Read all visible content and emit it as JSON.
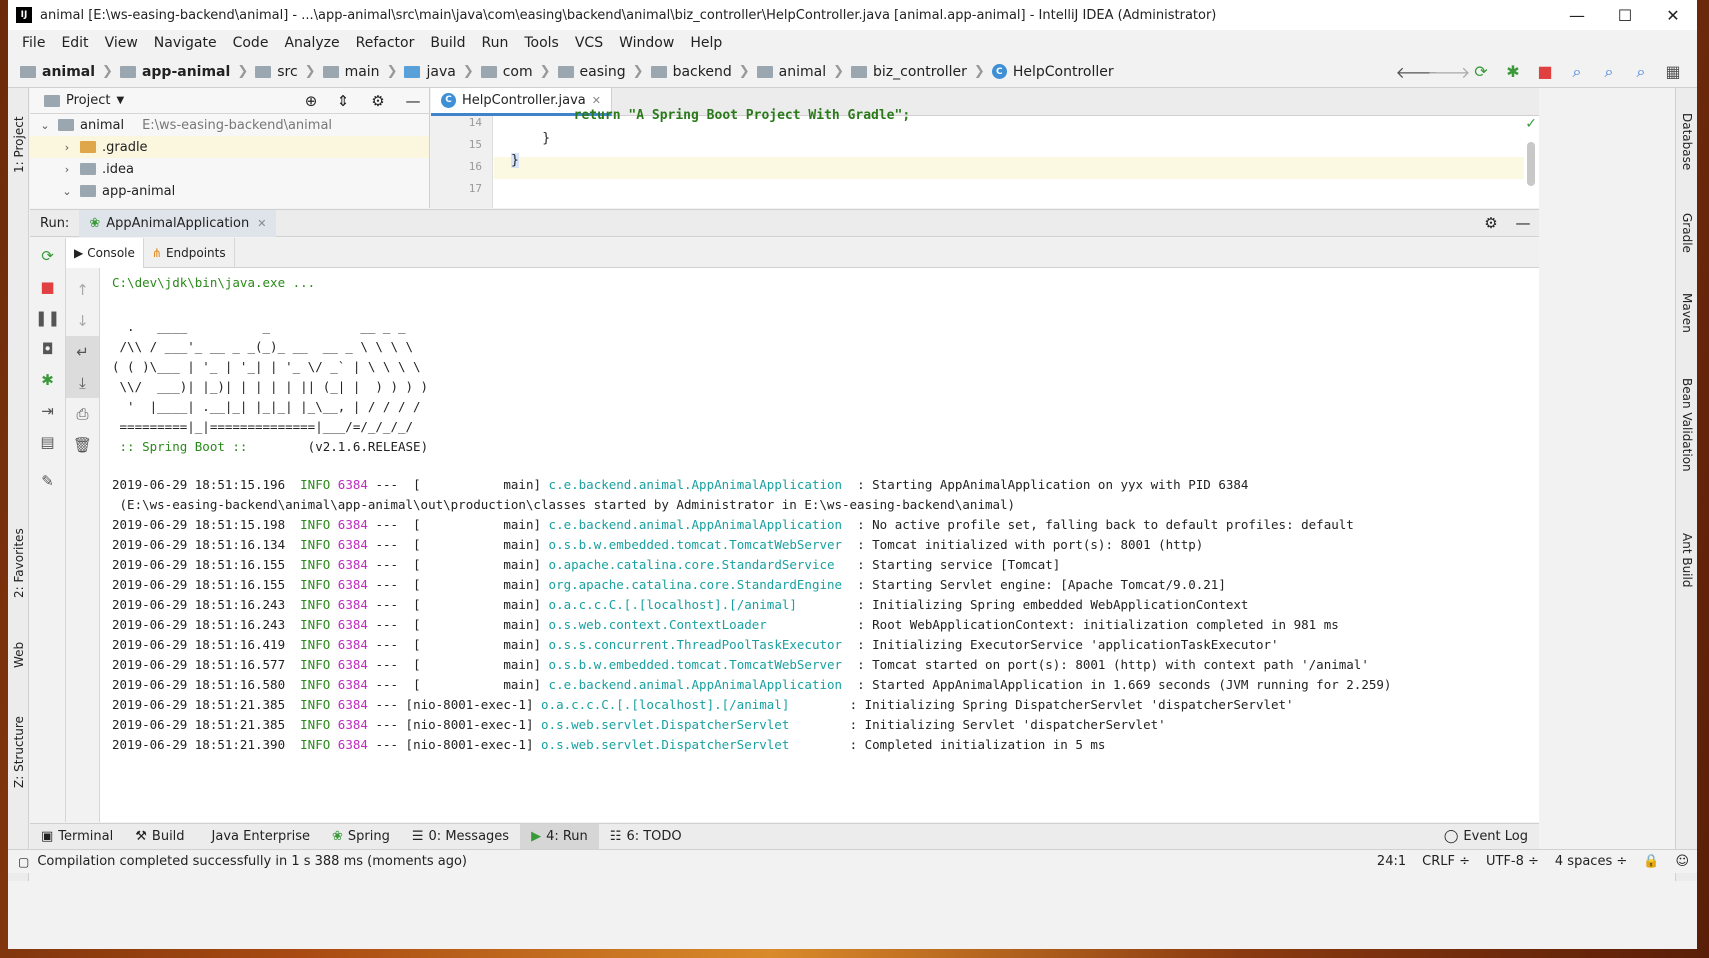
{
  "window": {
    "title": "animal [E:\\ws-easing-backend\\animal] - ...\\app-animal\\src\\main\\java\\com\\easing\\backend\\animal\\biz_controller\\HelpController.java [animal.app-animal] - IntelliJ IDEA (Administrator)",
    "logo": "IJ",
    "minimize": "—",
    "maximize": "☐",
    "close": "✕"
  },
  "menu": [
    "File",
    "Edit",
    "View",
    "Navigate",
    "Code",
    "Analyze",
    "Refactor",
    "Build",
    "Run",
    "Tools",
    "VCS",
    "Window",
    "Help"
  ],
  "breadcrumbs": [
    "animal",
    "app-animal",
    "src",
    "main",
    "java",
    "com",
    "easing",
    "backend",
    "animal",
    "biz_controller",
    "HelpController"
  ],
  "project_panel": {
    "title": "Project",
    "tree": [
      {
        "name": "animal",
        "path": "E:\\ws-easing-backend\\animal",
        "level": 0,
        "expanded": true
      },
      {
        "name": ".gradle",
        "level": 1,
        "expanded": false
      },
      {
        "name": ".idea",
        "level": 1,
        "expanded": false
      },
      {
        "name": "app-animal",
        "level": 1,
        "expanded": true
      }
    ]
  },
  "editor": {
    "tab": "HelpController.java",
    "lines": [
      {
        "no": "14",
        "text": "        return \"A Spring Boot Project With Gradle\";"
      },
      {
        "no": "15",
        "text": "    }"
      },
      {
        "no": "16",
        "text": "}"
      },
      {
        "no": "17",
        "text": ""
      }
    ]
  },
  "run": {
    "label": "Run:",
    "config": "AppAnimalApplication",
    "tabs": [
      "Console",
      "Endpoints"
    ]
  },
  "console": {
    "command": "C:\\dev\\jdk\\bin\\java.exe ...",
    "banner": [
      "  .   ____          _            __ _ _",
      " /\\\\ / ___'_ __ _ _(_)_ __  __ _ \\ \\ \\ \\",
      "( ( )\\___ | '_ | '_| | '_ \\/ _` | \\ \\ \\ \\",
      " \\\\/  ___)| |_)| | | | | || (_| |  ) ) ) )",
      "  '  |____| .__|_| |_|_| |_\\__, | / / / /",
      " =========|_|==============|___/=/_/_/_/"
    ],
    "boot_label": " :: Spring Boot :: ",
    "boot_version": "       (v2.1.6.RELEASE)",
    "logs": [
      {
        "ts": "2019-06-29 18:51:15.196",
        "level": "INFO",
        "pid": "6384",
        "thread": "---  [           main]",
        "logger": "c.e.backend.animal.AppAnimalApplication ",
        "msg": " : Starting AppAnimalApplication on yyx with PID 6384"
      },
      {
        "cont": " (E:\\ws-easing-backend\\animal\\app-animal\\out\\production\\classes started by Administrator in E:\\ws-easing-backend\\animal)"
      },
      {
        "ts": "2019-06-29 18:51:15.198",
        "level": "INFO",
        "pid": "6384",
        "thread": "---  [           main]",
        "logger": "c.e.backend.animal.AppAnimalApplication ",
        "msg": " : No active profile set, falling back to default profiles: default"
      },
      {
        "ts": "2019-06-29 18:51:16.134",
        "level": "INFO",
        "pid": "6384",
        "thread": "---  [           main]",
        "logger": "o.s.b.w.embedded.tomcat.TomcatWebServer ",
        "msg": " : Tomcat initialized with port(s): 8001 (http)"
      },
      {
        "ts": "2019-06-29 18:51:16.155",
        "level": "INFO",
        "pid": "6384",
        "thread": "---  [           main]",
        "logger": "o.apache.catalina.core.StandardService  ",
        "msg": " : Starting service [Tomcat]"
      },
      {
        "ts": "2019-06-29 18:51:16.155",
        "level": "INFO",
        "pid": "6384",
        "thread": "---  [           main]",
        "logger": "org.apache.catalina.core.StandardEngine ",
        "msg": " : Starting Servlet engine: [Apache Tomcat/9.0.21]"
      },
      {
        "ts": "2019-06-29 18:51:16.243",
        "level": "INFO",
        "pid": "6384",
        "thread": "---  [           main]",
        "logger": "o.a.c.c.C.[.[localhost].[/animal]       ",
        "msg": " : Initializing Spring embedded WebApplicationContext"
      },
      {
        "ts": "2019-06-29 18:51:16.243",
        "level": "INFO",
        "pid": "6384",
        "thread": "---  [           main]",
        "logger": "o.s.web.context.ContextLoader           ",
        "msg": " : Root WebApplicationContext: initialization completed in 981 ms"
      },
      {
        "ts": "2019-06-29 18:51:16.419",
        "level": "INFO",
        "pid": "6384",
        "thread": "---  [           main]",
        "logger": "o.s.s.concurrent.ThreadPoolTaskExecutor ",
        "msg": " : Initializing ExecutorService 'applicationTaskExecutor'"
      },
      {
        "ts": "2019-06-29 18:51:16.577",
        "level": "INFO",
        "pid": "6384",
        "thread": "---  [           main]",
        "logger": "o.s.b.w.embedded.tomcat.TomcatWebServer ",
        "msg": " : Tomcat started on port(s): 8001 (http) with context path '/animal'"
      },
      {
        "ts": "2019-06-29 18:51:16.580",
        "level": "INFO",
        "pid": "6384",
        "thread": "---  [           main]",
        "logger": "c.e.backend.animal.AppAnimalApplication ",
        "msg": " : Started AppAnimalApplication in 1.669 seconds (JVM running for 2.259)"
      },
      {
        "ts": "2019-06-29 18:51:21.385",
        "level": "INFO",
        "pid": "6384",
        "thread": "--- [nio-8001-exec-1]",
        "logger": "o.a.c.c.C.[.[localhost].[/animal]       ",
        "msg": " : Initializing Spring DispatcherServlet 'dispatcherServlet'"
      },
      {
        "ts": "2019-06-29 18:51:21.385",
        "level": "INFO",
        "pid": "6384",
        "thread": "--- [nio-8001-exec-1]",
        "logger": "o.s.web.servlet.DispatcherServlet       ",
        "msg": " : Initializing Servlet 'dispatcherServlet'"
      },
      {
        "ts": "2019-06-29 18:51:21.390",
        "level": "INFO",
        "pid": "6384",
        "thread": "--- [nio-8001-exec-1]",
        "logger": "o.s.web.servlet.DispatcherServlet       ",
        "msg": " : Completed initialization in 5 ms"
      }
    ]
  },
  "left_tool_tabs": [
    "1: Project",
    "2: Favorites",
    "Web",
    "Z: Structure"
  ],
  "right_tool_tabs": [
    "Database",
    "Gradle",
    "Maven",
    "Bean Validation",
    "Ant Build"
  ],
  "bottom_tabs": [
    "Terminal",
    "Build",
    "Java Enterprise",
    "Spring",
    "0: Messages",
    "4: Run",
    "6: TODO"
  ],
  "event_log": "Event Log",
  "status": {
    "message": "Compilation completed successfully in 1 s 388 ms (moments ago)",
    "position": "24:1",
    "line_sep": "CRLF ÷",
    "encoding": "UTF-8 ÷",
    "indent": "4 spaces ÷"
  },
  "colors": {
    "accent": "#4083c9",
    "log_info": "#2a8a1a",
    "log_pid": "#c02bc0",
    "log_logger": "#1aa0a0",
    "stop": "#e04040"
  }
}
